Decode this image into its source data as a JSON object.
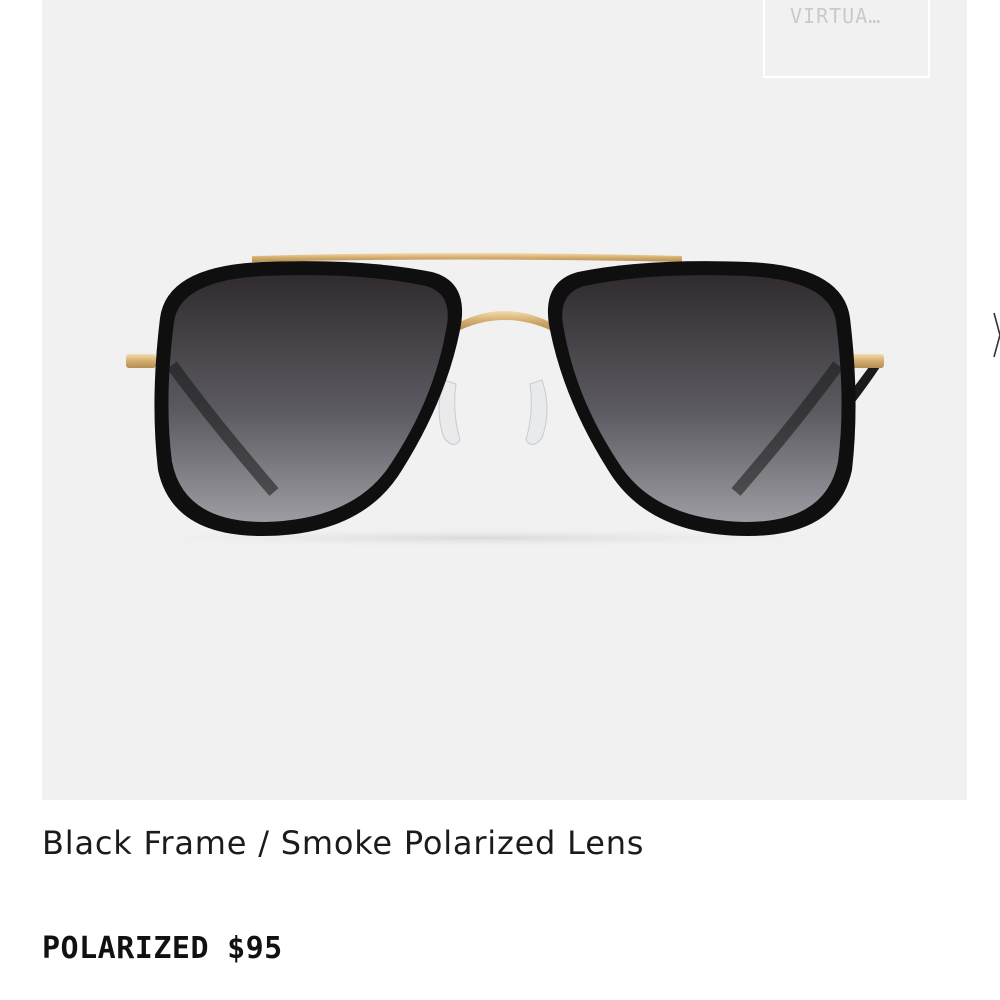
{
  "virtual_try_on": {
    "label": "VIRTUA…",
    "text_color": "#c9cacc"
  },
  "product": {
    "title": "Black Frame / Smoke Polarized Lens",
    "lens_type": "POLARIZED",
    "price": "$95",
    "image_background": "#f1f1f2",
    "frame_color": "#111111",
    "metal_color": "#d9b77a",
    "lens_color": "#3a3638"
  },
  "navigation": {
    "next_icon": "chevron-right-icon"
  }
}
